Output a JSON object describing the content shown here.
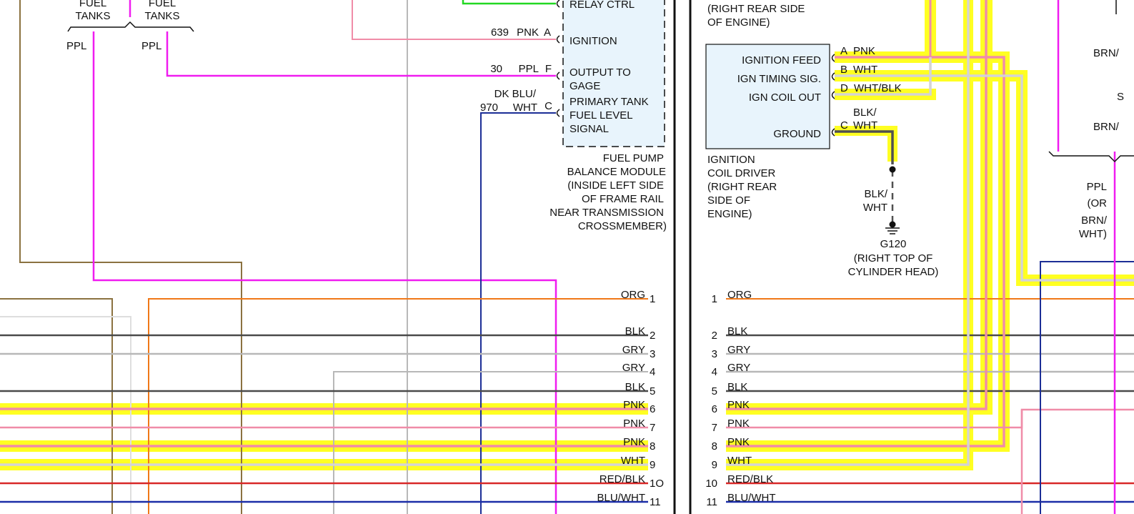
{
  "colors": {
    "ORG": "#f07818",
    "BLK": "#4a4a4a",
    "GRY": "#b8b8b8",
    "PNK": "#f08ca8",
    "WHT": "#d4d4d4",
    "RED_BLK": "#d82828",
    "BLU_WHT": "#1c2ea8",
    "PPL": "#f01cf0",
    "TAN": "#8b7240",
    "GREEN": "#22d822",
    "DKBLU": "#1c2e96",
    "HILITE": "#ffff22",
    "MODULE_FILL": "#e8f4fc",
    "LINE": "#111111"
  },
  "left_top": {
    "fuel_tanks_1": [
      "FUEL",
      "TANKS"
    ],
    "fuel_tanks_2": [
      "FUEL",
      "TANKS"
    ],
    "ppl_1": "PPL",
    "ppl_2": "PPL"
  },
  "module": {
    "name": [
      "FUEL PUMP",
      "BALANCE MODULE",
      "(INSIDE LEFT SIDE",
      "OF FRAME RAIL",
      "NEAR TRANSMISSION",
      "CROSSMEMBER)"
    ],
    "pins": [
      {
        "circuit": "",
        "color": "",
        "pin": "",
        "label": [
          "RELAY CTRL"
        ]
      },
      {
        "circuit": "639",
        "color": "PNK",
        "pin": "A",
        "label": [
          "IGNITION"
        ]
      },
      {
        "circuit": "30",
        "color": "PPL",
        "pin": "F",
        "label": [
          "OUTPUT TO",
          "GAGE"
        ]
      },
      {
        "circuit": "970",
        "color": "WHT",
        "color_top": "DK BLU/",
        "pin": "C",
        "label": [
          "PRIMARY TANK",
          "FUEL LEVEL",
          "SIGNAL"
        ]
      }
    ]
  },
  "right_top": {
    "location_fragment": [
      "(RIGHT REAR SIDE",
      "OF ENGINE)"
    ],
    "driver_name": [
      "IGNITION",
      "COIL DRIVER",
      "(RIGHT REAR",
      "SIDE OF",
      "ENGINE)"
    ],
    "driver_pins": [
      {
        "label": "IGNITION FEED",
        "pin": "A",
        "color": "PNK"
      },
      {
        "label": "IGN TIMING SIG.",
        "pin": "B",
        "color": "WHT"
      },
      {
        "label": "IGN COIL OUT",
        "pin": "D",
        "color": "WHT/BLK"
      },
      {
        "label": "GROUND",
        "pin": "C",
        "color": "WHT",
        "color_top": "BLK/"
      }
    ],
    "ground_wire": [
      "BLK/",
      "WHT"
    ],
    "ground": {
      "id": "G120",
      "location": [
        "(RIGHT TOP OF",
        "CYLINDER HEAD)"
      ]
    },
    "far_right": {
      "brn_1": "BRN/",
      "s": "S",
      "brn_2": "BRN/",
      "ppl_note": [
        "PPL",
        "(OR",
        "BRN/",
        "WHT)"
      ]
    }
  },
  "connector_rows": [
    {
      "num": "1",
      "color": "ORG"
    },
    {
      "num": "2",
      "color": "BLK"
    },
    {
      "num": "3",
      "color": "GRY"
    },
    {
      "num": "4",
      "color": "GRY"
    },
    {
      "num": "5",
      "color": "BLK"
    },
    {
      "num": "6",
      "color": "PNK"
    },
    {
      "num": "7",
      "color": "PNK"
    },
    {
      "num": "8",
      "color": "PNK"
    },
    {
      "num": "9",
      "color": "WHT"
    },
    {
      "num": "1O",
      "num_right": "10",
      "color": "RED/BLK"
    },
    {
      "num": "11",
      "color": "BLU/WHT"
    }
  ]
}
